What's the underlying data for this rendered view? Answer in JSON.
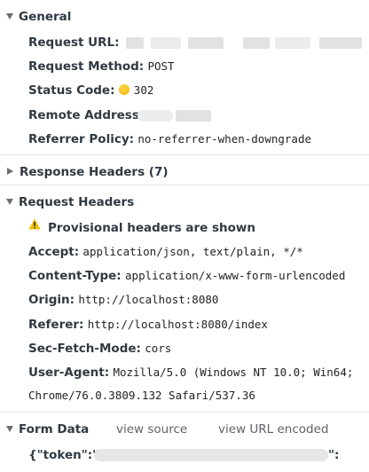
{
  "general": {
    "title": "General",
    "request_url_key": "Request URL:",
    "request_method_key": "Request Method:",
    "request_method": "POST",
    "status_code_key": "Status Code:",
    "status_code": "302",
    "status_color": "#f0b000",
    "remote_address_key": "Remote Address:",
    "referrer_policy_key": "Referrer Policy:",
    "referrer_policy": "no-referrer-when-downgrade"
  },
  "response_headers": {
    "title": "Response Headers (7)"
  },
  "request_headers": {
    "title": "Request Headers",
    "warning_icon": "warning-icon",
    "warning_color": "#f2c200",
    "provisional": "Provisional headers are shown",
    "accept_key": "Accept:",
    "accept": "application/json, text/plain, */*",
    "content_type_key": "Content-Type:",
    "content_type": "application/x-www-form-urlencoded",
    "origin_key": "Origin:",
    "origin": "http://localhost:8080",
    "referer_key": "Referer:",
    "referer": "http://localhost:8080/index",
    "sec_fetch_mode_key": "Sec-Fetch-Mode:",
    "sec_fetch_mode": "cors",
    "user_agent_key": "User-Agent:",
    "user_agent_line1": "Mozilla/5.0 (Windows NT 10.0; Win64;",
    "user_agent_line2": "Chrome/76.0.3809.132 Safari/537.36"
  },
  "form_data": {
    "title": "Form Data",
    "view_source": "view source",
    "view_url_encoded": "view URL encoded",
    "token_prefix": "{\"token\":\"",
    "token_suffix": "\":"
  }
}
